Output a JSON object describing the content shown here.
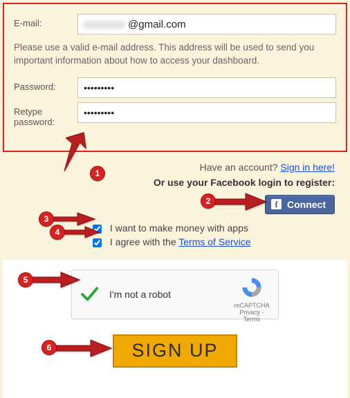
{
  "form": {
    "email_label": "E-mail:",
    "email_value_hidden": "xxxxxxxx",
    "email_value_domain": "@gmail.com",
    "help_text": "Please use a valid e-mail address. This address will be used to send you important information about how to access your dashboard.",
    "password_label": "Password:",
    "password_value": "•••••••••",
    "retype_label": "Retype password:",
    "retype_value": "•••••••••"
  },
  "signin": {
    "prompt": "Have an account? ",
    "link": "Sign in here!"
  },
  "facebook": {
    "prompt": "Or use your Facebook login to register:",
    "button": "Connect",
    "icon_letter": "f"
  },
  "checks": {
    "money_label": "I want to make money with apps",
    "money_checked": true,
    "terms_prefix": "I agree with the ",
    "terms_link": "Terms of Service",
    "terms_checked": true
  },
  "recaptcha": {
    "label": "I'm not a robot",
    "brand": "reCAPTCHA",
    "privacy": "Privacy",
    "terms": "Terms"
  },
  "signup_button": "SIGN UP",
  "annotations": {
    "b1": "1",
    "b2": "2",
    "b3": "3",
    "b4": "4",
    "b5": "5",
    "b6": "6"
  }
}
